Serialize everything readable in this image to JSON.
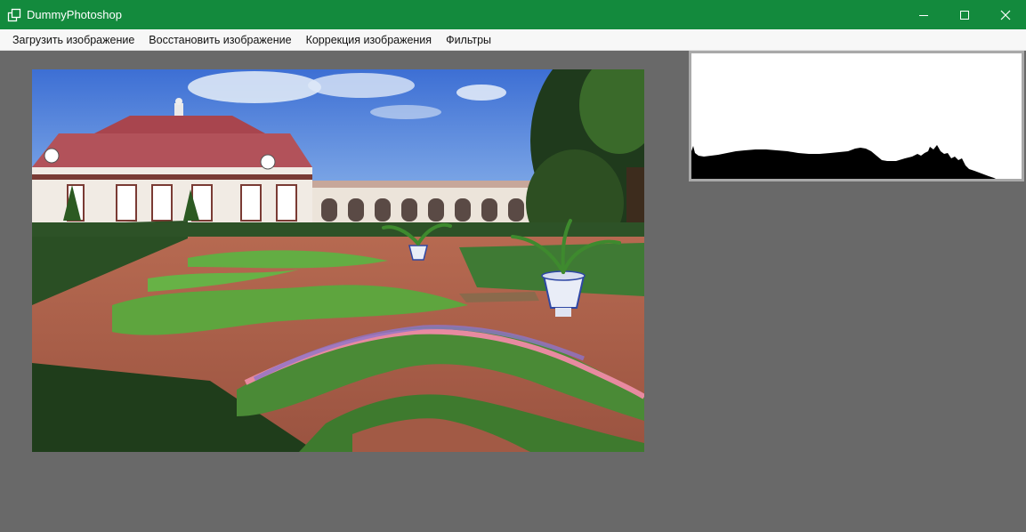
{
  "window": {
    "title": "DummyPhotoshop",
    "app_icon": "window-app-icon",
    "controls": [
      "minimize-icon",
      "maximize-icon",
      "close-icon"
    ]
  },
  "menu": {
    "items": [
      {
        "label": "Загрузить изображение"
      },
      {
        "label": "Восстановить изображение"
      },
      {
        "label": "Коррекция изображения"
      },
      {
        "label": "Фильтры"
      }
    ]
  },
  "colors": {
    "titlebar": "#138a3d",
    "workspace": "#696969",
    "menubar": "#f7f7f7",
    "histogram_fill": "#000000"
  }
}
